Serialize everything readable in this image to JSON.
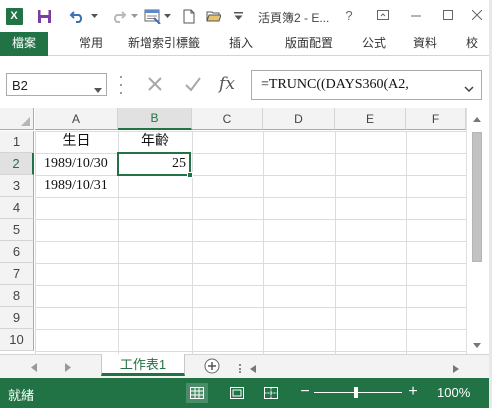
{
  "app": {
    "title": "活頁簿2 - E...",
    "logo_letter": "X",
    "brand_color": "#217346",
    "quick_access": [
      "excel-logo",
      "save-icon",
      "undo-icon",
      "redo-icon",
      "form-icon",
      "new-file-icon",
      "open-icon",
      "customize-icon"
    ],
    "window_controls": [
      "help-icon",
      "ribbon-display-icon",
      "minimize-icon",
      "maximize-icon",
      "close-icon"
    ]
  },
  "ribbon": {
    "file_tab": "檔案",
    "tabs": [
      "常用",
      "新增索引標籤",
      "插入",
      "版面配置",
      "公式",
      "資料",
      "校"
    ]
  },
  "formula_bar": {
    "name_box": "B2",
    "cancel_icon": "cancel-icon",
    "enter_icon": "check-icon",
    "fx_label": "fx",
    "formula": "=TRUNC((DAYS360(A2,"
  },
  "grid": {
    "columns": [
      "A",
      "B",
      "C",
      "D",
      "E",
      "F"
    ],
    "rows": [
      "1",
      "2",
      "3",
      "4",
      "5",
      "6",
      "7",
      "8",
      "9",
      "10"
    ],
    "cells": {
      "A1": "生日",
      "B1": "年齡",
      "A2": "1989/10/30",
      "B2": "25",
      "A3": "1989/10/31"
    },
    "selected_cell": "B2"
  },
  "sheets": {
    "tabs": [
      "工作表1"
    ],
    "active": "工作表1"
  },
  "status": {
    "text": "就緒",
    "zoom": "100%",
    "zoom_level": 100,
    "views": [
      "normal-view-icon",
      "page-layout-icon",
      "page-break-icon"
    ]
  }
}
